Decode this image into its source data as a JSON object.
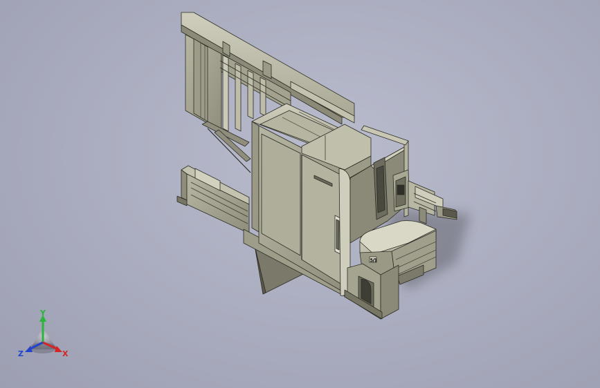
{
  "viewport": {
    "background": "#aeb1c3",
    "model_color": "#a6a592",
    "edge_color": "#2b2b24"
  },
  "triad": {
    "x_label": "X",
    "y_label": "Y",
    "z_label": "Z",
    "x_color": "#d62424",
    "y_color": "#2bb53a",
    "z_color": "#2244cc"
  },
  "model": {
    "nameplate": "",
    "corner_label": "5/1"
  }
}
